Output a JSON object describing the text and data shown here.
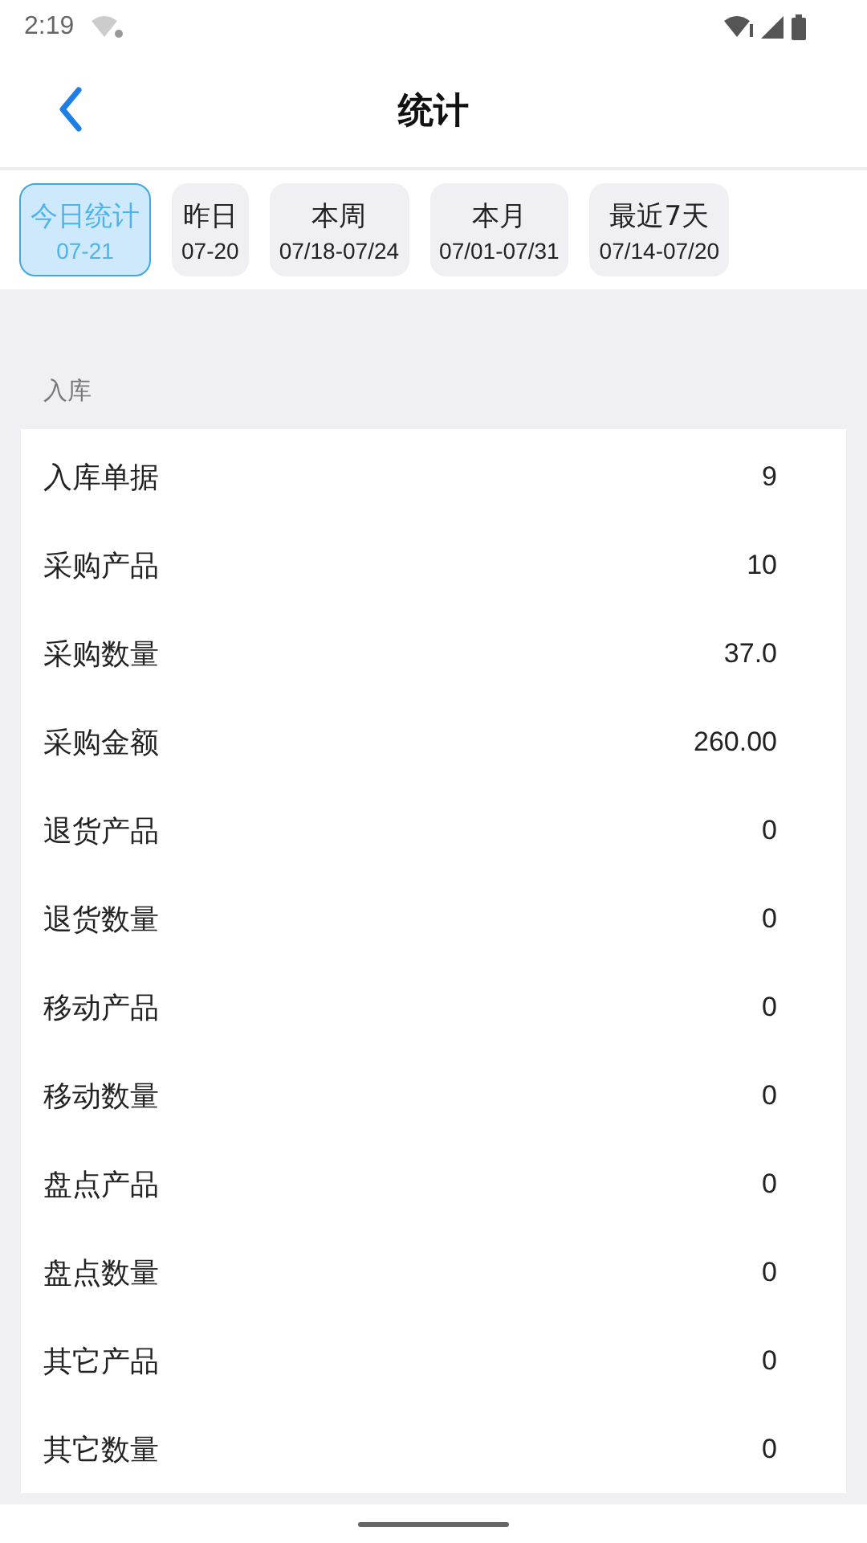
{
  "status_bar": {
    "time": "2:19"
  },
  "header": {
    "title": "统计"
  },
  "tabs": [
    {
      "label": "今日统计",
      "date": "07-21",
      "selected": true
    },
    {
      "label": "昨日",
      "date": "07-20",
      "selected": false
    },
    {
      "label": "本周",
      "date": "07/18-07/24",
      "selected": false
    },
    {
      "label": "本月",
      "date": "07/01-07/31",
      "selected": false
    },
    {
      "label": "最近7天",
      "date": "07/14-07/20",
      "selected": false
    }
  ],
  "section": {
    "title": "入库",
    "rows": [
      {
        "label": "入库单据",
        "value": "9"
      },
      {
        "label": "采购产品",
        "value": "10"
      },
      {
        "label": "采购数量",
        "value": "37.0"
      },
      {
        "label": "采购金额",
        "value": "260.00"
      },
      {
        "label": "退货产品",
        "value": "0"
      },
      {
        "label": "退货数量",
        "value": "0"
      },
      {
        "label": "移动产品",
        "value": "0"
      },
      {
        "label": "移动数量",
        "value": "0"
      },
      {
        "label": "盘点产品",
        "value": "0"
      },
      {
        "label": "盘点数量",
        "value": "0"
      },
      {
        "label": "其它产品",
        "value": "0"
      },
      {
        "label": "其它数量",
        "value": "0"
      }
    ]
  }
}
